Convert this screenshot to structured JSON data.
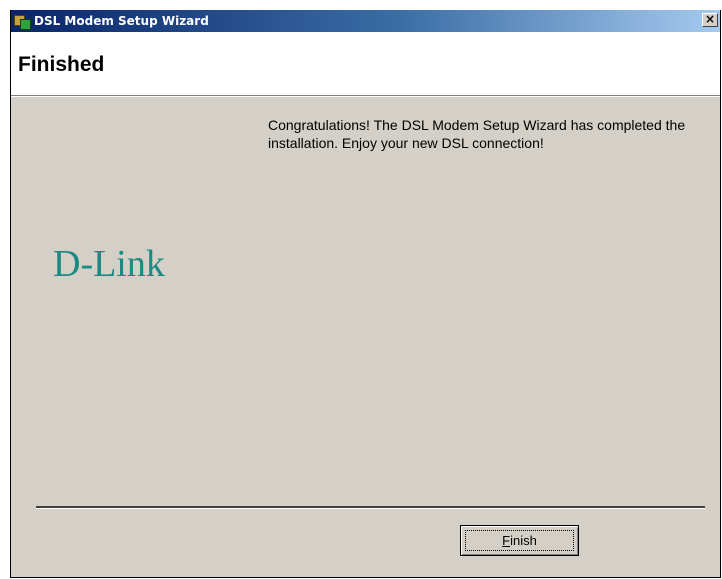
{
  "window": {
    "title": "DSL Modem Setup Wizard",
    "close_glyph": "×",
    "icon": "modem-setup-icon"
  },
  "header": {
    "title": "Finished"
  },
  "main": {
    "message": "Congratulations!  The DSL Modem Setup Wizard has completed the installation.  Enjoy your new DSL connection!",
    "logo_text": "D-Link",
    "logo_color": "#1a8a82"
  },
  "footer": {
    "finish_label_mnemonic": "F",
    "finish_label_rest": "inish"
  }
}
